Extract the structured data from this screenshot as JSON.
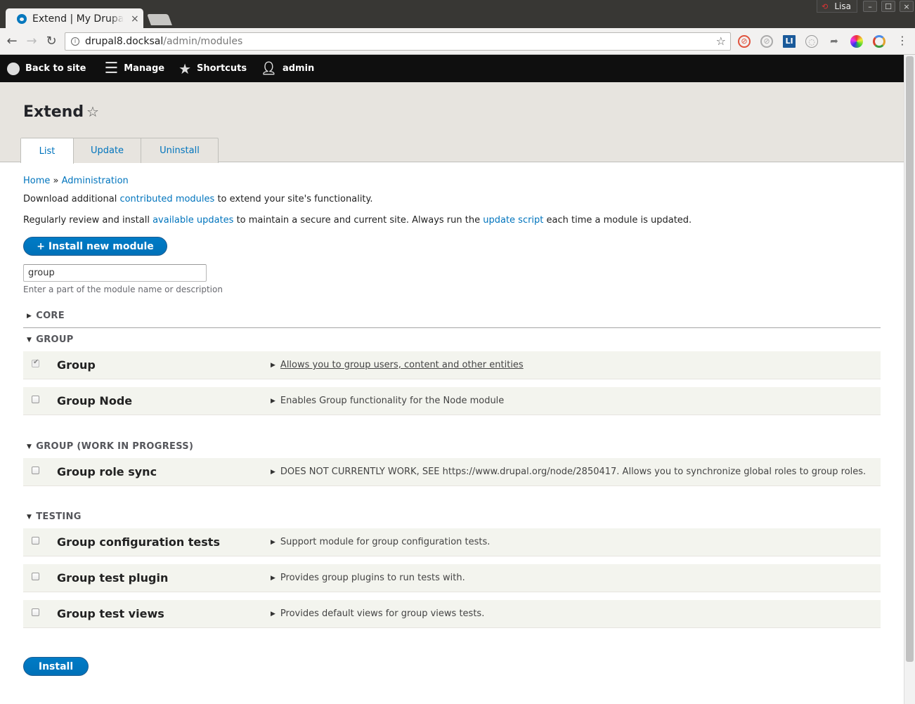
{
  "browser": {
    "tab_title": "Extend | My Drupal",
    "tab_close": "×",
    "profile_name": "Lisa",
    "url_host": "drupal8.docksal",
    "url_path": "/admin/modules",
    "window_buttons": [
      "–",
      "☐",
      "×"
    ]
  },
  "admin_toolbar": {
    "back": "Back to site",
    "manage": "Manage",
    "shortcuts": "Shortcuts",
    "user": "admin"
  },
  "header": {
    "title": "Extend",
    "tabs": [
      {
        "label": "List",
        "active": true
      },
      {
        "label": "Update",
        "active": false
      },
      {
        "label": "Uninstall",
        "active": false
      }
    ]
  },
  "breadcrumb": {
    "home": "Home",
    "sep": "»",
    "admin": "Administration"
  },
  "intro": {
    "p1_a": "Download additional ",
    "p1_link": "contributed modules",
    "p1_b": " to extend your site's functionality.",
    "p2_a": "Regularly review and install ",
    "p2_link1": "available updates",
    "p2_b": " to maintain a secure and current site. Always run the ",
    "p2_link2": "update script",
    "p2_c": " each time a module is updated."
  },
  "install_new_label": "+ Install new module",
  "filter": {
    "value": "group",
    "description": "Enter a part of the module name or description"
  },
  "packages": {
    "core": "CORE",
    "group": "GROUP",
    "group_wip": "GROUP (WORK IN PROGRESS)",
    "testing": "TESTING"
  },
  "modules": [
    {
      "name": "Group",
      "description": "Allows you to group users, content and other entities",
      "checked": true
    },
    {
      "name": "Group Node",
      "description": "Enables Group functionality for the Node module",
      "checked": false
    },
    {
      "name": "Group role sync",
      "description": "DOES NOT CURRENTLY WORK, SEE https://www.drupal.org/node/2850417. Allows you to synchronize global roles to group roles.",
      "checked": false
    },
    {
      "name": "Group configuration tests",
      "description": "Support module for group configuration tests.",
      "checked": false
    },
    {
      "name": "Group test plugin",
      "description": "Provides group plugins to run tests with.",
      "checked": false
    },
    {
      "name": "Group test views",
      "description": "Provides default views for group views tests.",
      "checked": false
    }
  ],
  "install_label": "Install",
  "colors": {
    "accent": "#0074bd",
    "button": "#0071b8",
    "toolbar_bg": "#0f0f0f",
    "header_bg": "#e7e4df",
    "row_bg": "#f3f4ee"
  }
}
